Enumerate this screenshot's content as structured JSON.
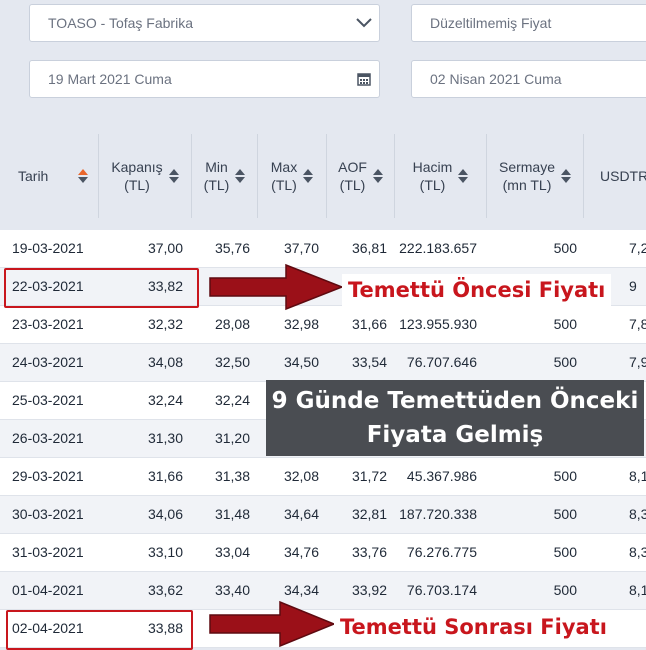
{
  "filters": {
    "stock": "TOASO - Tofaş Fabrika",
    "price_type": "Düzeltilmemiş Fiyat",
    "start_date": "19 Mart 2021 Cuma",
    "end_date": "02 Nisan 2021 Cuma"
  },
  "table": {
    "headers": {
      "date": "Tarih",
      "close_1": "Kapanış",
      "close_2": "(TL)",
      "min_1": "Min",
      "min_2": "(TL)",
      "max_1": "Max",
      "max_2": "(TL)",
      "aof_1": "AOF",
      "aof_2": "(TL)",
      "vol_1": "Hacim",
      "vol_2": "(TL)",
      "cap_1": "Sermaye",
      "cap_2": "(mn TL)",
      "usd": "USDTR"
    },
    "rows": [
      {
        "date": "19-03-2021",
        "close": "37,00",
        "min": "35,76",
        "max": "37,70",
        "aof": "36,81",
        "vol": "222.183.657",
        "cap": "500",
        "usd": "7,2"
      },
      {
        "date": "22-03-2021",
        "close": "33,82",
        "min": "",
        "max": "",
        "aof": "",
        "vol": "",
        "cap": "",
        "usd": "9"
      },
      {
        "date": "23-03-2021",
        "close": "32,32",
        "min": "28,08",
        "max": "32,98",
        "aof": "31,66",
        "vol": "123.955.930",
        "cap": "500",
        "usd": "7,8"
      },
      {
        "date": "24-03-2021",
        "close": "34,08",
        "min": "32,50",
        "max": "34,50",
        "aof": "33,54",
        "vol": "76.707.646",
        "cap": "500",
        "usd": "7,9"
      },
      {
        "date": "25-03-2021",
        "close": "32,24",
        "min": "32,24",
        "max": "",
        "aof": "",
        "vol": "",
        "cap": "",
        "usd": ""
      },
      {
        "date": "26-03-2021",
        "close": "31,30",
        "min": "31,20",
        "max": "",
        "aof": "",
        "vol": "",
        "cap": "",
        "usd": ""
      },
      {
        "date": "29-03-2021",
        "close": "31,66",
        "min": "31,38",
        "max": "32,08",
        "aof": "31,72",
        "vol": "45.367.986",
        "cap": "500",
        "usd": "8,1"
      },
      {
        "date": "30-03-2021",
        "close": "34,06",
        "min": "31,48",
        "max": "34,64",
        "aof": "32,81",
        "vol": "187.720.338",
        "cap": "500",
        "usd": "8,3"
      },
      {
        "date": "31-03-2021",
        "close": "33,10",
        "min": "33,04",
        "max": "34,76",
        "aof": "33,76",
        "vol": "76.276.775",
        "cap": "500",
        "usd": "8,3"
      },
      {
        "date": "01-04-2021",
        "close": "33,62",
        "min": "33,40",
        "max": "34,34",
        "aof": "33,92",
        "vol": "76.703.174",
        "cap": "500",
        "usd": "8,1"
      },
      {
        "date": "02-04-2021",
        "close": "33,88",
        "min": "",
        "max": "",
        "aof": "",
        "vol": "",
        "cap": "",
        "usd": ""
      }
    ]
  },
  "annotations": {
    "before": "Temettü Öncesi Fiyatı",
    "after": "Temettü Sonrası Fiyatı",
    "banner_line1": "9 Günde Temettüden Önceki",
    "banner_line2": "Fiyata Gelmiş"
  },
  "colors": {
    "highlight": "#c8161d",
    "sort_active": "#e8662c",
    "banner": "#4a4d52"
  },
  "icons": {
    "stock_select": "chevron-down-icon",
    "start_date": "calendar-icon",
    "sort": "sort-arrows-icon"
  }
}
